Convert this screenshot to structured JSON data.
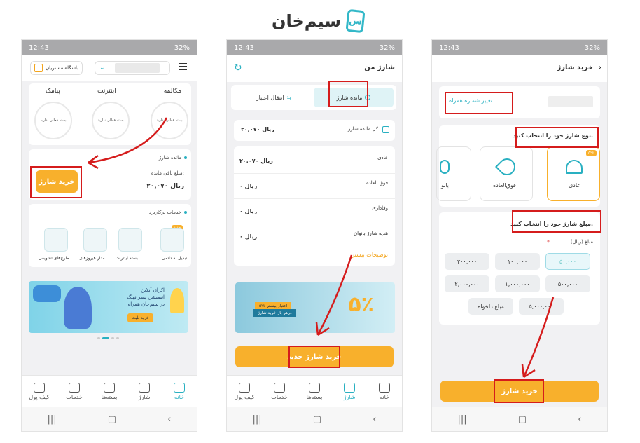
{
  "logo": {
    "text": "سیم‌خان",
    "mark": "س"
  },
  "status": {
    "time": "12:43",
    "battery": "32%"
  },
  "phone1": {
    "club_label": "باشگاه مشتریان",
    "tabs3": [
      "مکالمه",
      "اینترنت",
      "پیامک"
    ],
    "no_pkg": "بسته فعالی ندارید",
    "balance_title": "مانده شارژ",
    "balance_label": "مبلغ باقی مانده:",
    "balance_value": "۲۰,۰۷۰ ریال",
    "buy_btn": "خرید شارژ",
    "services_title": "خدمات پرکاربرد",
    "new_badge": "جدید",
    "services": [
      "تبدیل به دائمی",
      "بسته اینترنت",
      "مدار هیروزهای",
      "طرح‌های تشویقی"
    ],
    "banner_line1": "اکران آنلاین",
    "banner_line2": "انیمیشن پسر نهنگ",
    "banner_line3": "در سیم‌خان همراه",
    "banner_btn": "خرید بلیت"
  },
  "phone2": {
    "title": "شارژ من",
    "tab_active": "مانده شارژ",
    "tab_other": "انتقال اعتبار",
    "total_label": "کل مانده شارژ",
    "total_value": "۲۰,۰۷۰ ریال",
    "rows": [
      {
        "label": "عادی",
        "value": "۲۰,۰۷۰ ریال"
      },
      {
        "label": "فوق العاده",
        "value": "۰ ریال"
      },
      {
        "label": "وفاداری",
        "value": "۰ ریال"
      },
      {
        "label": "هدیه شارژ بانوان",
        "value": "۰ ریال"
      }
    ],
    "more": "توضیحات بیشتر",
    "banner_l1": "۵% اعتبار بیشتر",
    "banner_l2": "درهر بار خرید شارژ",
    "banner_big": "۵٪",
    "buy_btn": "خرید شارژ جدید"
  },
  "phone3": {
    "title": "خرید شارژ",
    "change_number": "تغییر شماره همراه",
    "type_title": "نوع شارژ خود را انتخاب کنید.",
    "types": [
      {
        "label": "عادی",
        "badge": "۵%"
      },
      {
        "label": "فوق‌العاده",
        "badge": ""
      },
      {
        "label": "بانو",
        "badge": ""
      }
    ],
    "amount_title": "مبلغ شارژ خود را انتخاب کنید.",
    "amount_label": "مبلغ (ریال)",
    "amounts": [
      "۵۰,۰۰۰",
      "۱۰۰,۰۰۰",
      "۲۰۰,۰۰۰",
      "۵۰۰,۰۰۰",
      "۱,۰۰۰,۰۰۰",
      "۲,۰۰۰,۰۰۰",
      "۵,۰۰۰,۰۰۰",
      "مبلغ دلخواه"
    ],
    "buy_btn": "خرید شارژ"
  },
  "tabbar": [
    "خانه",
    "شارژ",
    "بسته‌ها",
    "خدمات",
    "کیف پول"
  ],
  "colors": {
    "accent": "#29b0c1",
    "orange": "#f8b02c",
    "red_highlight": "#d51c1c"
  }
}
